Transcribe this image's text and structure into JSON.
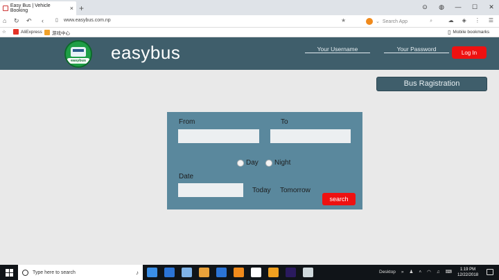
{
  "browser": {
    "tab_title": "Easy Bus | Vehicle Booking",
    "tab_close": "×",
    "new_tab": "+",
    "url": "www.easybus.com.np",
    "search_placeholder": "Search App",
    "bookmarks": [
      {
        "label": "AliExpress",
        "color": "#e43226"
      },
      {
        "label": "游戏中心",
        "color": "#f0a22a"
      }
    ],
    "mobile_bookmarks": "Mobile bookmarks"
  },
  "site": {
    "logo_text": "easybus",
    "brand": "easybus",
    "username_placeholder": "Your Username",
    "password_placeholder": "Your Password",
    "login_label": "Log In",
    "register_label": "Bus Ragistration",
    "colors": {
      "header": "#3f5e6b",
      "panel": "#5a889d",
      "accent_red": "#ee1111",
      "logo_green": "#1f9e46"
    }
  },
  "search_form": {
    "from_label": "From",
    "to_label": "To",
    "day_label": "Day",
    "night_label": "Night",
    "date_label": "Date",
    "today_label": "Today",
    "tomorrow_label": "Tomorrow",
    "search_label": "search"
  },
  "taskbar": {
    "search_placeholder": "Type here to search",
    "desktop_label": "Desktop",
    "desktop_chevron": "»",
    "time": "1:19 PM",
    "date": "12/22/2018",
    "app_colors": [
      "#3a8ee6",
      "#2b74d6",
      "#7fb3e8",
      "#e8a13a",
      "#2b74d6",
      "#f08a1c",
      "#ffffff",
      "#f0a020",
      "#2a1a5e",
      "#cfd8dc"
    ]
  }
}
